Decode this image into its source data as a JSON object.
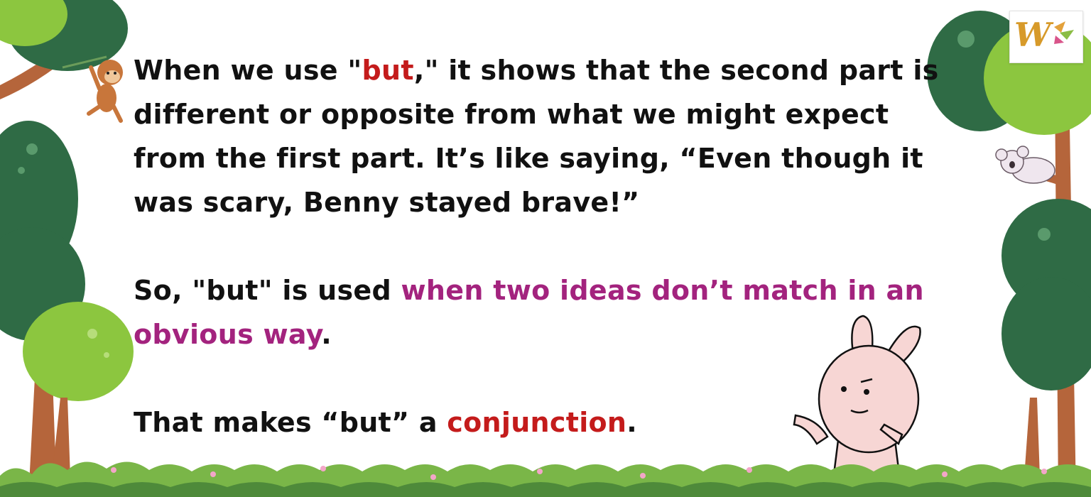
{
  "paragraph1": {
    "t1": "When we use \"",
    "highlight": "but",
    "t2": ",\" it shows that the second part is different or opposite from what we might expect from the first part. It’s like saying, “Even though it was scary, Benny stayed brave!”"
  },
  "paragraph2": {
    "t1": "So, \"but\" is used ",
    "highlight": "when two ideas don’t match in an obvious way",
    "t2": "."
  },
  "paragraph3": {
    "t1": "That makes “but” a ",
    "highlight": "conjunction",
    "t2": "."
  },
  "logo": {
    "letter": "W",
    "icon": "worksheet-logo-icon"
  },
  "colors": {
    "body_text": "#111111",
    "red_highlight": "#c41b1b",
    "magenta_highlight": "#a3237e",
    "tree_dark": "#2f6b45",
    "tree_light": "#8cc63f",
    "trunk": "#b5653b",
    "bunny": "#f7d6d4"
  },
  "decorations": [
    "tree-icon",
    "monkey-icon",
    "koala-icon",
    "bunny-icon",
    "flower-bush-icon"
  ]
}
